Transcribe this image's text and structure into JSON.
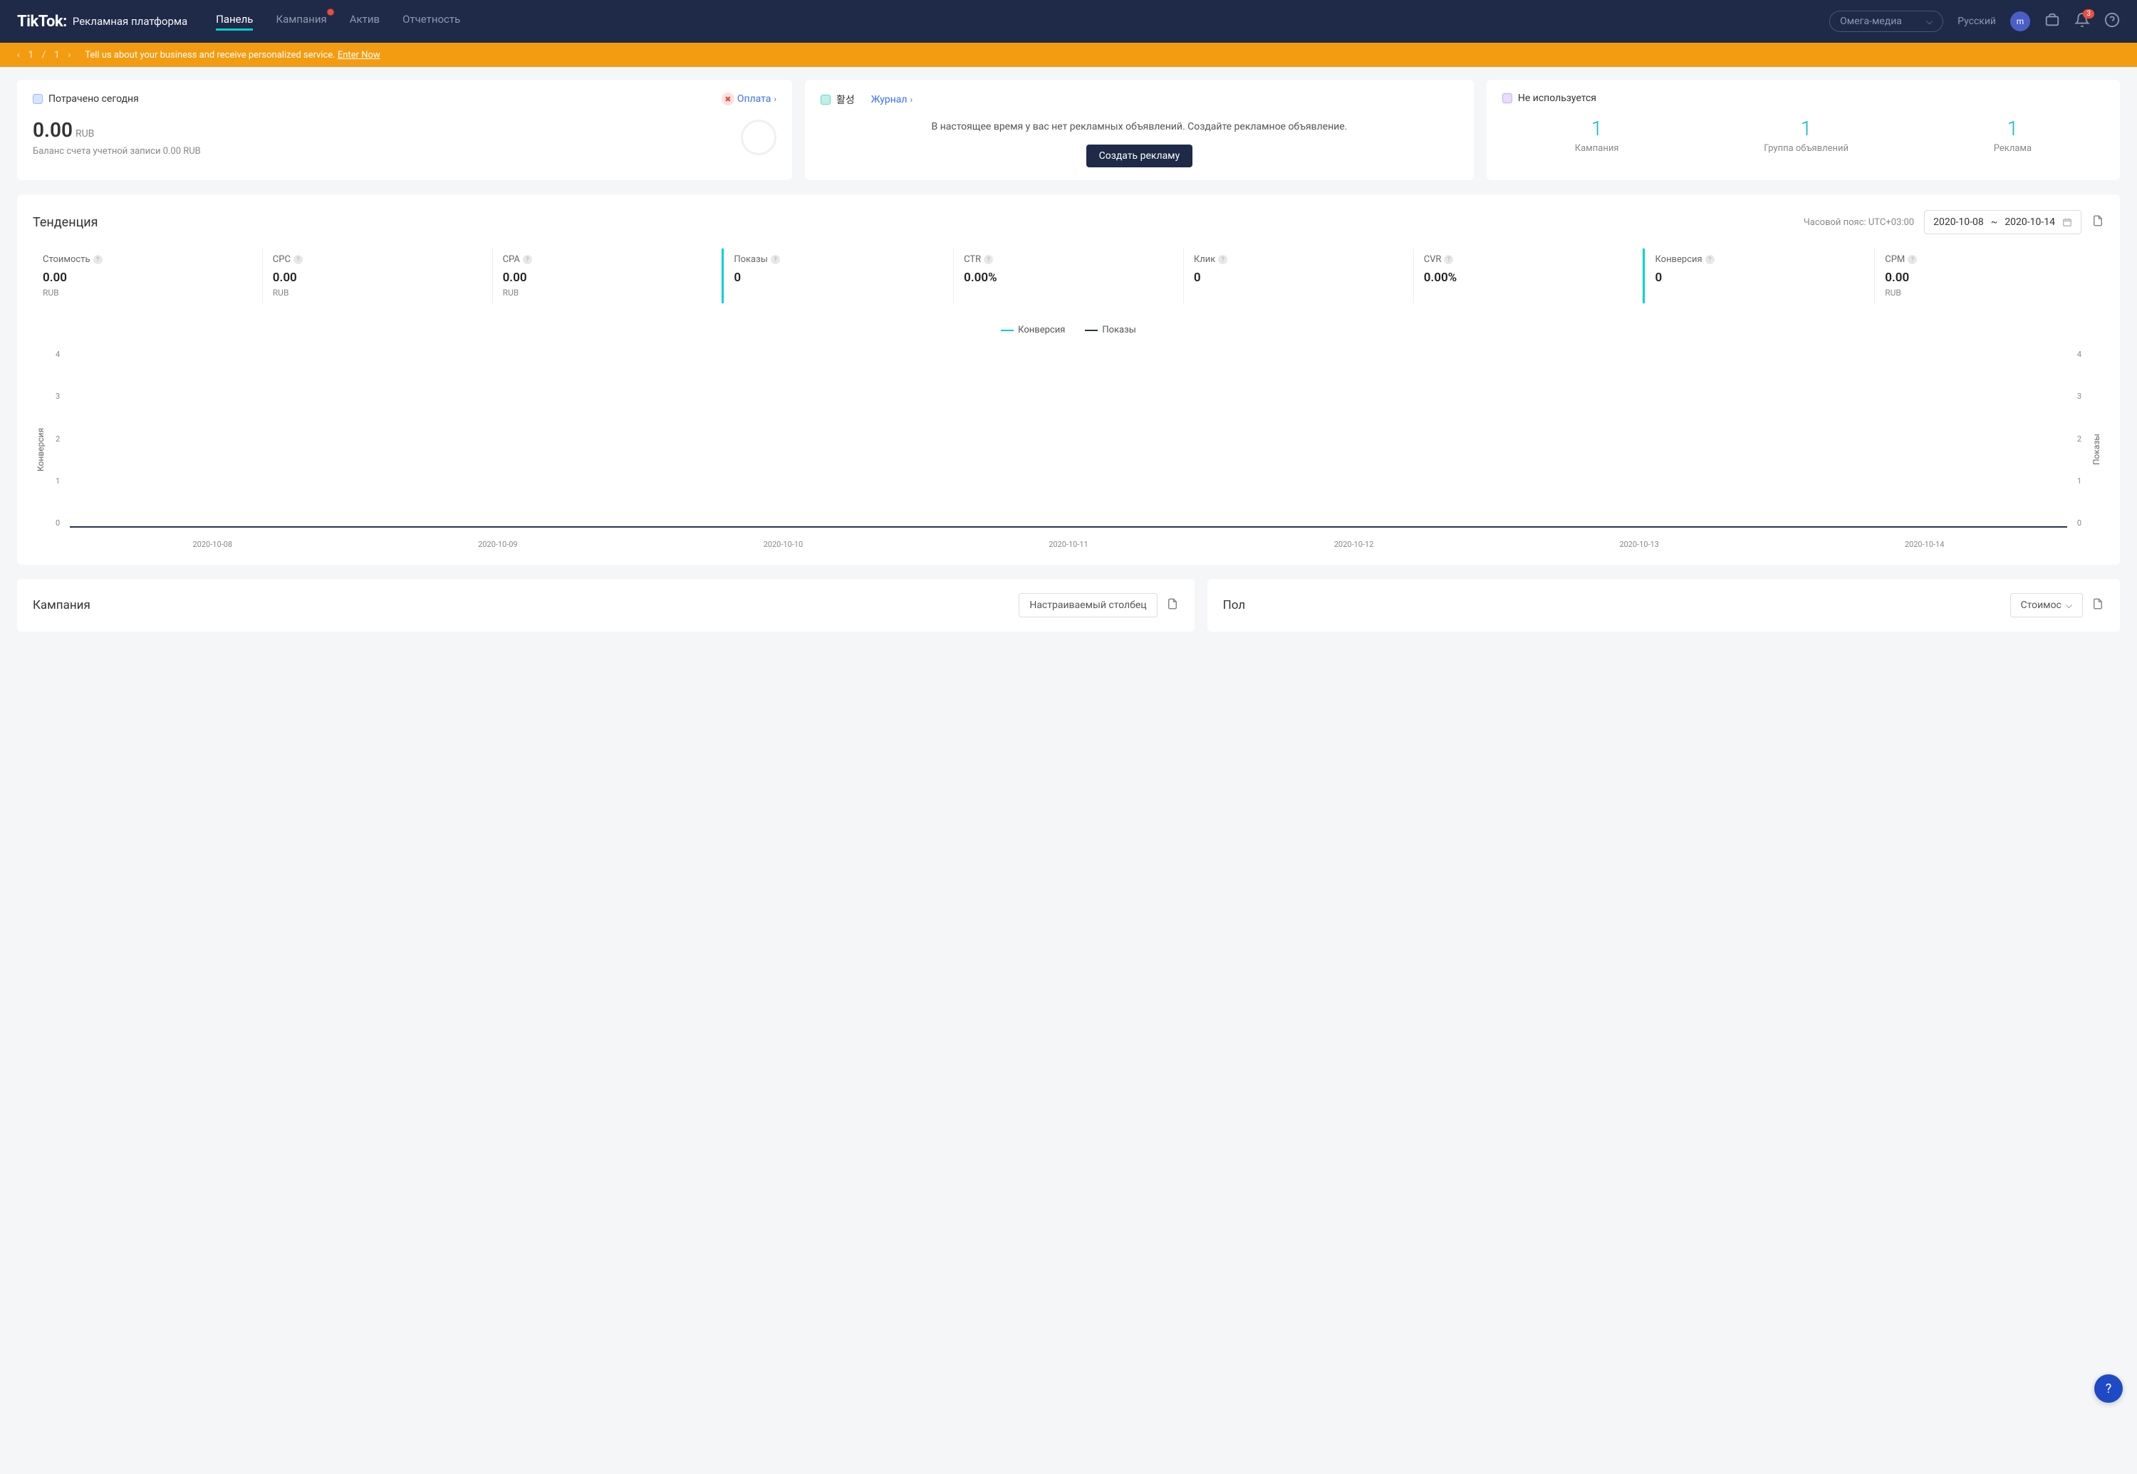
{
  "header": {
    "logo": "TikTok:",
    "logo_sub": "Рекламная платформа",
    "nav": [
      "Панель",
      "Кампания",
      "Актив",
      "Отчетность"
    ],
    "account": "Омега-медиа",
    "language": "Русский",
    "avatar": "m",
    "notif_count": "3"
  },
  "banner": {
    "page": "1",
    "sep": "/",
    "total": "1",
    "msg": "Tell us about your business and receive personalized service. ",
    "link": "Enter Now"
  },
  "card_spend": {
    "title": "Потрачено сегодня",
    "link": "Оплата",
    "amount": "0.00",
    "currency": "RUB",
    "balance": "Баланс счета учетной записи 0.00 RUB"
  },
  "card_active": {
    "title": "활성",
    "link": "Журнал",
    "msg": "В настоящее время у вас нет рекламных объявлений. Создайте рекламное объявление.",
    "btn": "Создать рекламу"
  },
  "card_unused": {
    "title": "Не используется",
    "stats": [
      {
        "num": "1",
        "label": "Кампания"
      },
      {
        "num": "1",
        "label": "Группа объявлений"
      },
      {
        "num": "1",
        "label": "Реклама"
      }
    ]
  },
  "tendency": {
    "title": "Тенденция",
    "tz": "Часовой пояс: UTC+03:00",
    "date_from": "2020-10-08",
    "date_sep": "~",
    "date_to": "2020-10-14",
    "metrics": [
      {
        "label": "Стоимость",
        "value": "0.00",
        "unit": "RUB"
      },
      {
        "label": "CPC",
        "value": "0.00",
        "unit": "RUB"
      },
      {
        "label": "CPA",
        "value": "0.00",
        "unit": "RUB"
      },
      {
        "label": "Показы",
        "value": "0",
        "unit": ""
      },
      {
        "label": "CTR",
        "value": "0.00%",
        "unit": ""
      },
      {
        "label": "Клик",
        "value": "0",
        "unit": ""
      },
      {
        "label": "CVR",
        "value": "0.00%",
        "unit": ""
      },
      {
        "label": "Конверсия",
        "value": "0",
        "unit": ""
      },
      {
        "label": "CPM",
        "value": "0.00",
        "unit": "RUB"
      }
    ],
    "legend": [
      "Конверсия",
      "Показы"
    ],
    "y_label_left": "Конверсия",
    "y_label_right": "Показы"
  },
  "chart_data": {
    "type": "line",
    "categories": [
      "2020-10-08",
      "2020-10-09",
      "2020-10-10",
      "2020-10-11",
      "2020-10-12",
      "2020-10-13",
      "2020-10-14"
    ],
    "series": [
      {
        "name": "Конверсия",
        "values": [
          0,
          0,
          0,
          0,
          0,
          0,
          0
        ],
        "color": "#00d1d1"
      },
      {
        "name": "Показы",
        "values": [
          0,
          0,
          0,
          0,
          0,
          0,
          0
        ],
        "color": "#26334f"
      }
    ],
    "ylim": [
      0,
      4
    ],
    "yticks": [
      0,
      1,
      2,
      3,
      4
    ],
    "ylabel_left": "Конверсия",
    "ylabel_right": "Показы"
  },
  "bottom": {
    "campaign_title": "Кампания",
    "custom_col": "Настраиваемый столбец",
    "gender_title": "Пол",
    "cost_sel": "Стоимос"
  }
}
